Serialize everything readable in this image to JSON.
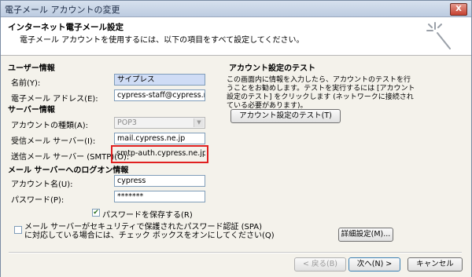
{
  "window": {
    "title": "電子メール アカウントの変更",
    "close_label": "X"
  },
  "header": {
    "title": "インターネット電子メール設定",
    "subtitle": "電子メール アカウントを使用するには、以下の項目をすべて設定してください。"
  },
  "user_section": {
    "title": "ユーザー情報",
    "name_label": "名前(Y):",
    "name_value": "サイプレス",
    "email_label": "電子メール アドレス(E):",
    "email_value": "cypress-staff@cypress.ne.jp"
  },
  "server_section": {
    "title": "サーバー情報",
    "account_type_label": "アカウントの種類(A):",
    "account_type_value": "POP3",
    "incoming_label": "受信メール サーバー(I):",
    "incoming_value": "mail.cypress.ne.jp",
    "outgoing_label": "送信メール サーバー (SMTP)(O):",
    "outgoing_value": "smtp-auth.cypress.ne.jp"
  },
  "logon_section": {
    "title": "メール サーバーへのログオン情報",
    "account_label": "アカウント名(U):",
    "account_value": "cypress",
    "password_label": "パスワード(P):",
    "password_value": "*******",
    "save_password_label": "パスワードを保存する(R)",
    "spa_label_line1": "メール サーバーがセキュリティで保護されたパスワード認証 (SPA)",
    "spa_label_line2": "に対応している場合には、チェック ボックスをオンにしてください(Q)"
  },
  "test_section": {
    "title": "アカウント設定のテスト",
    "description": "この画面内に情報を入力したら、アカウントのテストを行うことをお勧めします。テストを実行するには [アカウント設定のテスト] をクリックします (ネットワークに接続されている必要があります)。",
    "test_button": "アカウント設定のテスト(T)"
  },
  "buttons": {
    "more_settings": "詳細設定(M)...",
    "back": "< 戻る(B)",
    "next": "次へ(N) >",
    "cancel": "キャンセル"
  },
  "icons": {
    "close": "close-icon",
    "wizard": "wizard-sparkle-icon",
    "dropdown": "chevron-down-icon",
    "check": "checkmark-icon"
  },
  "colors": {
    "highlight_border": "#e02020",
    "autofill_bg": "#cfdcf5"
  }
}
